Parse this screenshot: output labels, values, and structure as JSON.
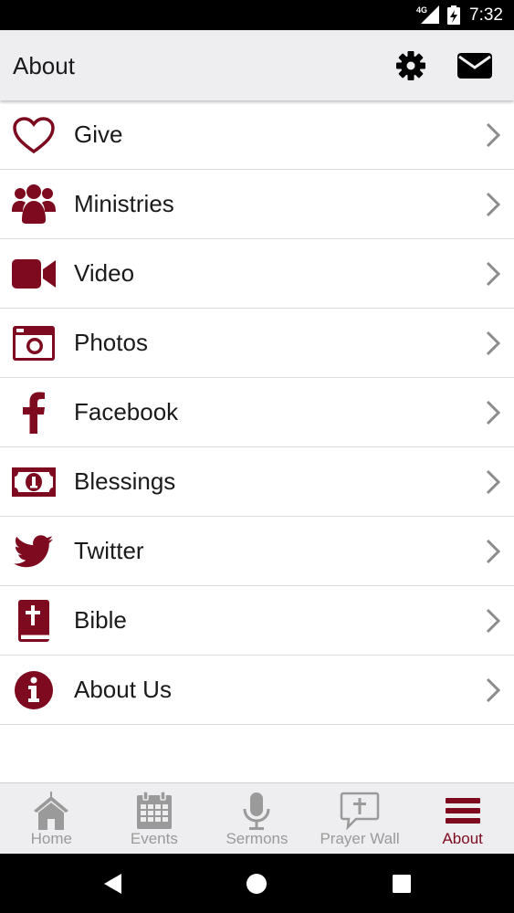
{
  "colors": {
    "accent": "#7d0a1e",
    "inactive": "#9a9a9a",
    "chevron": "#8c8c8c"
  },
  "status_bar": {
    "network": "4G",
    "time": "7:32"
  },
  "header": {
    "title": "About",
    "settings_icon": "gear-icon",
    "mail_icon": "envelope-icon"
  },
  "menu": {
    "items": [
      {
        "label": "Give",
        "icon": "heart-icon"
      },
      {
        "label": "Ministries",
        "icon": "users-icon"
      },
      {
        "label": "Video",
        "icon": "video-camera-icon"
      },
      {
        "label": "Photos",
        "icon": "camera-icon"
      },
      {
        "label": "Facebook",
        "icon": "facebook-icon"
      },
      {
        "label": "Blessings",
        "icon": "money-bill-icon"
      },
      {
        "label": "Twitter",
        "icon": "twitter-icon"
      },
      {
        "label": "Bible",
        "icon": "bible-icon"
      },
      {
        "label": "About Us",
        "icon": "info-icon"
      }
    ]
  },
  "tabs": [
    {
      "label": "Home",
      "icon": "home-icon",
      "active": false
    },
    {
      "label": "Events",
      "icon": "calendar-icon",
      "active": false
    },
    {
      "label": "Sermons",
      "icon": "microphone-icon",
      "active": false
    },
    {
      "label": "Prayer Wall",
      "icon": "prayer-bubble-icon",
      "active": false
    },
    {
      "label": "About",
      "icon": "menu-bars-icon",
      "active": true
    }
  ],
  "system_nav": {
    "back_icon": "back-triangle-icon",
    "home_icon": "home-circle-icon",
    "recents_icon": "recents-square-icon"
  }
}
